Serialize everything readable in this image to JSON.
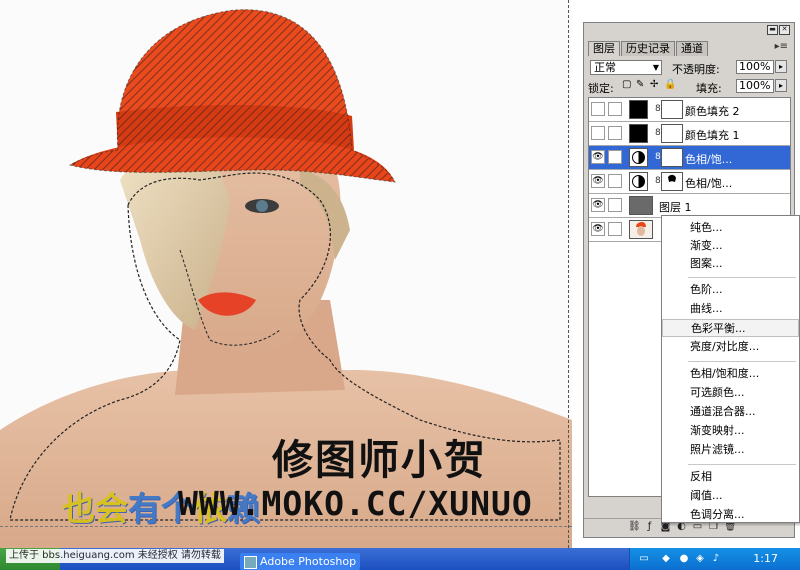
{
  "canvas": {
    "watermark_main": "修图师小贺",
    "watermark_url": "WWW.MOKO.CC/XUNUO",
    "slogan_part1": "也会",
    "slogan_part2": "有个",
    "slogan_part3": "依",
    "slogan_part4": "赖"
  },
  "layers_panel": {
    "tabs": [
      "图层",
      "历史记录",
      "通道"
    ],
    "blend_mode": "正常",
    "opacity_label": "不透明度:",
    "opacity_value": "100%",
    "lock_label": "锁定:",
    "fill_label": "填充:",
    "fill_value": "100%",
    "layers": [
      {
        "name": "颜色填充 2",
        "visible": false,
        "selected": false,
        "thumb": "black-fill",
        "mask": "white"
      },
      {
        "name": "颜色填充 1",
        "visible": false,
        "selected": false,
        "thumb": "black-fill",
        "mask": "white"
      },
      {
        "name": "色相/饱...",
        "visible": true,
        "selected": true,
        "thumb": "adjustment",
        "mask": "white"
      },
      {
        "name": "色相/饱...",
        "visible": true,
        "selected": false,
        "thumb": "adjustment",
        "mask": "silhouette"
      },
      {
        "name": "图层 1",
        "visible": true,
        "selected": false,
        "thumb": "gray-layer",
        "mask": ""
      },
      {
        "name": "",
        "visible": true,
        "selected": false,
        "thumb": "photo",
        "mask": ""
      }
    ],
    "bottom_icons": [
      "link-icon",
      "fx-icon",
      "mask-icon",
      "adjustment-icon",
      "folder-icon",
      "new-layer-icon",
      "trash-icon"
    ]
  },
  "context_menu": {
    "items": [
      "纯色...",
      "渐变...",
      "图案...",
      "色阶...",
      "曲线...",
      "色彩平衡...",
      "亮度/对比度...",
      "色相/饱和度...",
      "可选颜色...",
      "通道混合器...",
      "渐变映射...",
      "照片滤镜...",
      "反相",
      "阈值...",
      "色调分离..."
    ],
    "highlighted": "色彩平衡..."
  },
  "taskbar": {
    "upload_note": "上传于 bbs.heiguang.com 未经授权 请勿转载",
    "app_button": "Adobe Photoshop",
    "clock": "1:17"
  },
  "colors": {
    "hat": "#e8451b",
    "selected_layer": "#3168d5",
    "panel_bg": "#d6d3ce",
    "taskbar": "#245edb"
  }
}
